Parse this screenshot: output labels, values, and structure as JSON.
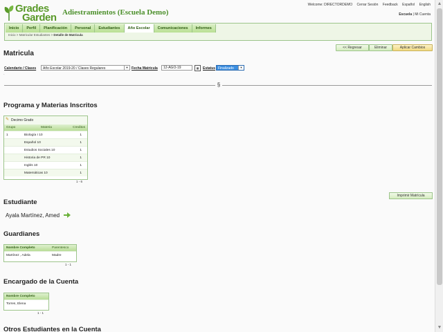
{
  "header": {
    "logo_line1": "Grades",
    "logo_line2": "Garden",
    "title": "Adiestramientos (Escuela Demo)",
    "welcome": "Welcome: DIRECTORDEMO",
    "logout": "Cerrar Sesión",
    "feedback": "Feedback",
    "lang_es": "Español",
    "lang_en": "English",
    "scope": "Escuela",
    "separator": "|",
    "my_account": "Mi Cuenta"
  },
  "nav": {
    "tabs": [
      "Inicio",
      "Perfil",
      "Planificación",
      "Personal",
      "Estudiantes",
      "Año Escolar",
      "Comunicaciones",
      "Informes"
    ],
    "active_index": 5,
    "breadcrumb": {
      "home": "Inicio",
      "sep": ">",
      "parent": "Matricular Estudiantes",
      "current": "Detalle de Matricula"
    }
  },
  "actions": {
    "back": "<< Regresar",
    "delete": "Eliminar",
    "apply": "Aplicar Cambios"
  },
  "page_title": "Matricula",
  "filters": {
    "calendar_label": "Calendario / Clases",
    "calendar_value": "Año Escolar 2019-20 / Clases Regulares",
    "date_label": "Fecha Matricula",
    "date_value": "12-AGO-19",
    "status_label": "Estatus",
    "status_value": "Finalizado"
  },
  "dot": ".",
  "section_mark": "§",
  "programs": {
    "heading": "Programa y Materias Inscritos",
    "program_name": "Decimo Grado",
    "columns": [
      "Grupo",
      "Materia",
      "Creditos"
    ],
    "rows": [
      [
        "1",
        "Biología I 10",
        "1"
      ],
      [
        "",
        "Español 10",
        "1"
      ],
      [
        "",
        "Estudios Sociales 10",
        "1"
      ],
      [
        "",
        "Historia de PR 10",
        "1"
      ],
      [
        "",
        "Inglés 10",
        "1"
      ],
      [
        "",
        "Matemáticas 10",
        "1"
      ]
    ],
    "pager": "1 - 6"
  },
  "print_button": "Imprimir Matrícula",
  "student": {
    "heading": "Estudiante",
    "name": "Ayala Martínez, Amed"
  },
  "guardians": {
    "heading": "Guardianes",
    "columns": [
      "Nombre Completo",
      "Parentesco"
    ],
    "rows": [
      [
        "Martínez , Adela",
        "Madre"
      ]
    ],
    "pager": "1 - 1"
  },
  "account_owner": {
    "heading": "Encargado de la Cuenta",
    "columns": [
      "Nombre Completo"
    ],
    "rows": [
      [
        "Torres, Elena"
      ]
    ],
    "pager": "1 - 1"
  },
  "other_students": {
    "heading": "Otros Estudiantes en la Cuenta"
  },
  "colors": {
    "brand_green": "#5a9a2a",
    "tab_green": "#b9df93",
    "status_blue": "#3c8ee0"
  }
}
